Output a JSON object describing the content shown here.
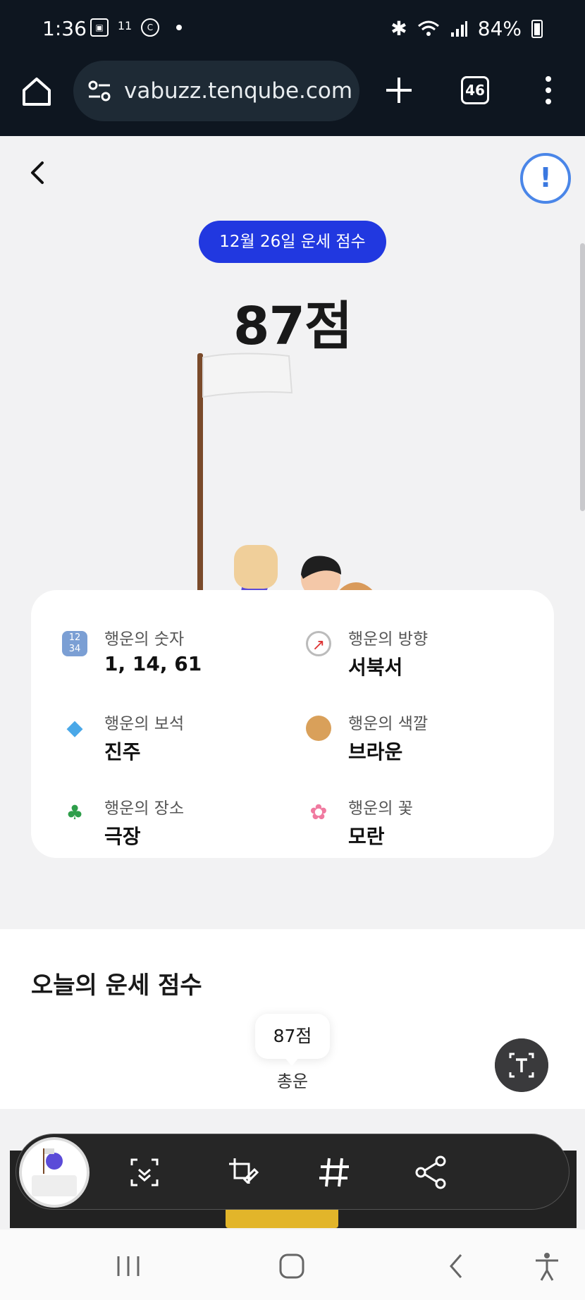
{
  "status_bar": {
    "time": "1:36",
    "notif_badge": "11",
    "battery": "84%"
  },
  "browser": {
    "url": "vabuzz.tenqube.com",
    "tab_count": "46"
  },
  "page": {
    "report_symbol": "!",
    "date_badge": "12월 26일 운세 점수",
    "score": "87점",
    "luck_items": [
      {
        "label": "행운의 숫자",
        "value": "1, 14, 61",
        "icon": "number-icon"
      },
      {
        "label": "행운의 방향",
        "value": "서북서",
        "icon": "compass-icon"
      },
      {
        "label": "행운의 보석",
        "value": "진주",
        "icon": "gem-icon"
      },
      {
        "label": "행운의 색깔",
        "value": "브라운",
        "icon": "palette-icon"
      },
      {
        "label": "행운의 장소",
        "value": "극장",
        "icon": "island-icon"
      },
      {
        "label": "행운의 꽃",
        "value": "모란",
        "icon": "flower-icon"
      }
    ],
    "section_title": "오늘의 운세 점수",
    "chart_tooltip": "87점",
    "chart_label": "총운"
  },
  "colors": {
    "accent": "#2138e0",
    "chrome_bg": "#0e1620",
    "report_blue": "#3a78e0"
  }
}
